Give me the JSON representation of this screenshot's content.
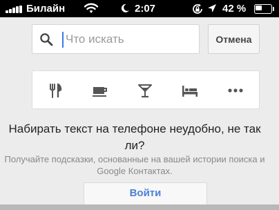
{
  "status_bar": {
    "carrier": "Билайн",
    "time": "2:07",
    "battery_percent": "42 %",
    "battery_level": 0.42,
    "icons": [
      "signal-icon",
      "wifi-icon",
      "moon-icon",
      "rotation-lock-icon",
      "location-icon",
      "battery-icon"
    ]
  },
  "search": {
    "placeholder": "Что искать",
    "value": "",
    "icon": "search-icon",
    "cancel_label": "Отмена"
  },
  "categories": [
    {
      "icon": "restaurant-icon"
    },
    {
      "icon": "cafe-icon"
    },
    {
      "icon": "bar-icon"
    },
    {
      "icon": "hotel-icon"
    },
    {
      "icon": "more-icon"
    }
  ],
  "hint": {
    "title": "Набирать текст на телефоне неудобно, не так ли?",
    "subtitle": "Получайте подсказки, основанные на вашей истории поиска и Google Контактах.",
    "signin_label": "Войти"
  },
  "colors": {
    "accent": "#3b78e7",
    "link": "#4a7fd8",
    "icon": "#555555",
    "background": "#ececec"
  }
}
